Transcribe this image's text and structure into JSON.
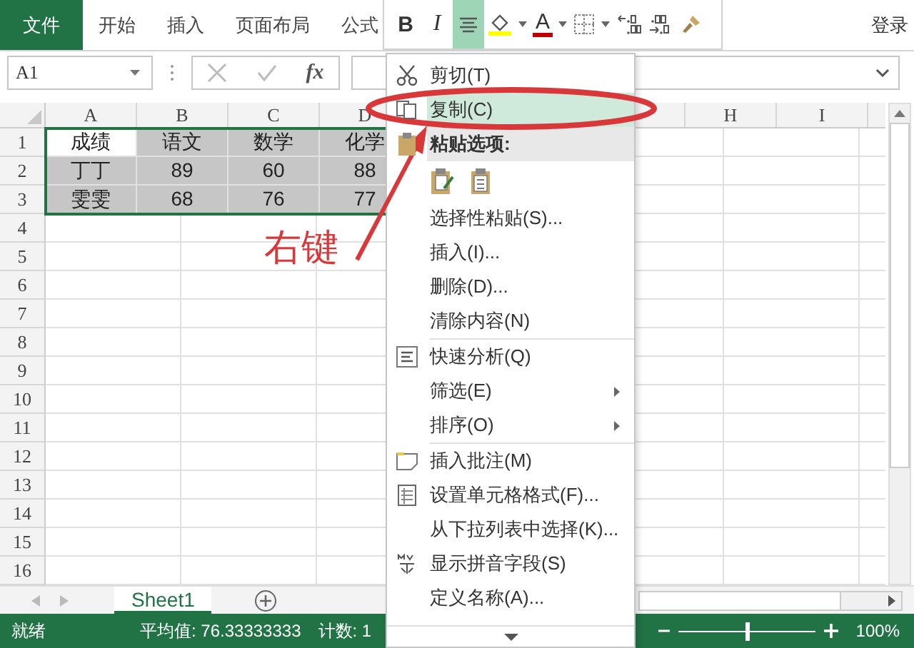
{
  "ribbon": {
    "tabs": [
      {
        "label": "文件",
        "kind": "file"
      },
      {
        "label": "开始",
        "kind": "tab"
      },
      {
        "label": "插入",
        "kind": "tab"
      },
      {
        "label": "页面布局",
        "kind": "tab"
      },
      {
        "label": "公式",
        "kind": "tab"
      }
    ],
    "sign_in": "登录"
  },
  "mini_toolbar": {
    "buttons": [
      {
        "kind": "bold",
        "text": "B",
        "selected": false
      },
      {
        "kind": "italic",
        "text": "I",
        "selected": false
      },
      {
        "kind": "align-center",
        "selected": true
      },
      {
        "kind": "fill-color",
        "selected": false
      },
      {
        "kind": "font-color",
        "text": "A",
        "selected": false
      },
      {
        "kind": "borders",
        "selected": false
      },
      {
        "kind": "increase-decimal",
        "selected": false
      },
      {
        "kind": "decrease-decimal",
        "selected": false
      },
      {
        "kind": "format-painter",
        "selected": false
      }
    ]
  },
  "formula_bar": {
    "name_box": "A1",
    "function_label": "fx"
  },
  "sheet": {
    "columns_left": [
      "A",
      "B",
      "C",
      "D"
    ],
    "columns_right": [
      "H",
      "I"
    ],
    "rows": [
      {
        "number": "1",
        "cells": [
          {
            "text": "成绩",
            "selected": true,
            "active": true
          },
          {
            "text": "语文",
            "selected": true,
            "active": false
          },
          {
            "text": "数学",
            "selected": true,
            "active": false
          },
          {
            "text": "化学",
            "selected": true,
            "active": false
          }
        ]
      },
      {
        "number": "2",
        "cells": [
          {
            "text": "丁丁",
            "selected": true,
            "active": false
          },
          {
            "text": "89",
            "selected": true,
            "active": false
          },
          {
            "text": "60",
            "selected": true,
            "active": false
          },
          {
            "text": "88",
            "selected": true,
            "active": false
          }
        ]
      },
      {
        "number": "3",
        "cells": [
          {
            "text": "雯雯",
            "selected": true,
            "active": false
          },
          {
            "text": "68",
            "selected": true,
            "active": false
          },
          {
            "text": "76",
            "selected": true,
            "active": false
          },
          {
            "text": "77",
            "selected": true,
            "active": false
          }
        ]
      },
      {
        "number": "4"
      },
      {
        "number": "5"
      },
      {
        "number": "6"
      },
      {
        "number": "7"
      },
      {
        "number": "8"
      },
      {
        "number": "9"
      },
      {
        "number": "10"
      },
      {
        "number": "11"
      },
      {
        "number": "12"
      },
      {
        "number": "13"
      },
      {
        "number": "14"
      },
      {
        "number": "15"
      },
      {
        "number": "16"
      }
    ]
  },
  "sheet_tabs": [
    {
      "label": "Sheet1",
      "selected": true
    }
  ],
  "status_bar": {
    "ready": "就绪",
    "average": "平均值: 76.33333333",
    "count": "计数: 1",
    "zoom": "100%",
    "level": 0.5
  },
  "context_menu": {
    "items": [
      {
        "kind": "item",
        "label": "剪切(T)",
        "selected": false,
        "submenu": false
      },
      {
        "kind": "item",
        "label": "复制(C)",
        "selected": true,
        "submenu": false
      },
      {
        "kind": "header",
        "label": "粘贴选项:"
      },
      {
        "kind": "paste-options"
      },
      {
        "kind": "item",
        "label": "选择性粘贴(S)...",
        "selected": false,
        "submenu": false
      },
      {
        "kind": "item",
        "label": "插入(I)...",
        "selected": false,
        "submenu": false
      },
      {
        "kind": "item",
        "label": "删除(D)...",
        "selected": false,
        "submenu": false
      },
      {
        "kind": "item",
        "label": "清除内容(N)",
        "selected": false,
        "submenu": false
      },
      {
        "kind": "separator"
      },
      {
        "kind": "item",
        "label": "快速分析(Q)",
        "selected": false,
        "submenu": false
      },
      {
        "kind": "item",
        "label": "筛选(E)",
        "selected": false,
        "submenu": true
      },
      {
        "kind": "item",
        "label": "排序(O)",
        "selected": false,
        "submenu": true
      },
      {
        "kind": "separator"
      },
      {
        "kind": "item",
        "label": "插入批注(M)",
        "selected": false,
        "submenu": false
      },
      {
        "kind": "item",
        "label": "设置单元格格式(F)...",
        "selected": false,
        "submenu": false
      },
      {
        "kind": "item",
        "label": "从下拉列表中选择(K)...",
        "selected": false,
        "submenu": false
      },
      {
        "kind": "item",
        "label": "显示拼音字段(S)",
        "selected": false,
        "submenu": false
      },
      {
        "kind": "item",
        "label": "定义名称(A)...",
        "selected": false,
        "submenu": false
      }
    ]
  },
  "annotation": {
    "label": "右键"
  }
}
